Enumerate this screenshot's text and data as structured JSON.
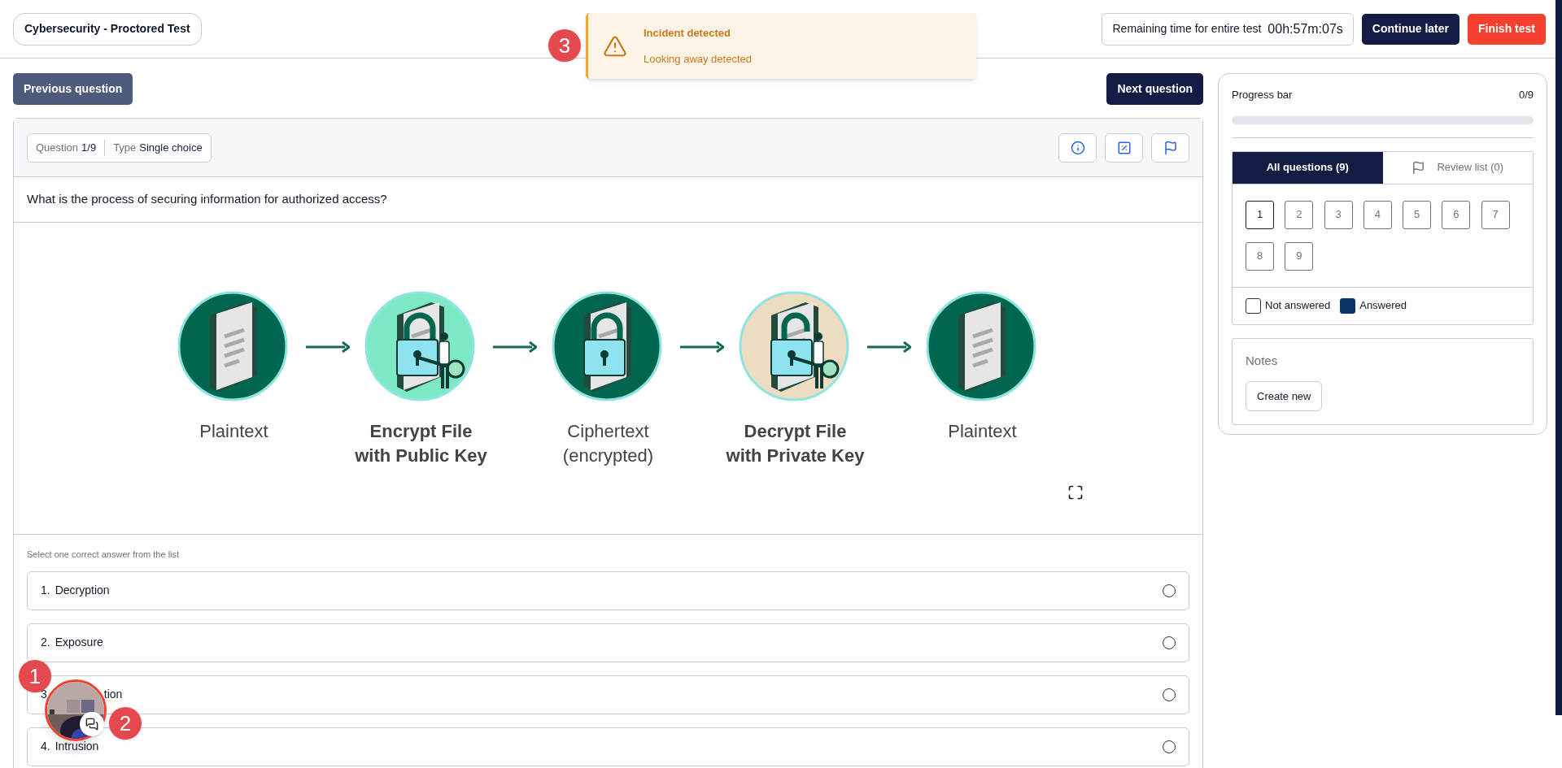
{
  "header": {
    "title": "Cybersecurity - Proctored Test",
    "timer_label": "Remaining time for entire test",
    "timer": "00h:57m:07s",
    "continue": "Continue later",
    "finish": "Finish test"
  },
  "alert": {
    "title": "Incident detected",
    "message": "Looking away detected",
    "badge": "3"
  },
  "nav": {
    "previous": "Previous question",
    "next": "Next question"
  },
  "question": {
    "number_label": "Question",
    "number": "1/9",
    "type_label": "Type",
    "type": "Single choice",
    "text": "What is the process of securing information for authorized access?",
    "diagram": [
      {
        "kind": "document",
        "color": "#00674f",
        "lines": [
          "Plaintext"
        ],
        "bold": false
      },
      {
        "kind": "encrypt",
        "color": "#7de8c5",
        "lines": [
          "Encrypt File",
          "with Public Key"
        ],
        "bold": true
      },
      {
        "kind": "locked",
        "color": "#00674f",
        "lines": [
          "Ciphertext",
          "(encrypted)"
        ],
        "bold": false
      },
      {
        "kind": "decrypt",
        "color": "#ecdcc0",
        "lines": [
          "Decrypt File",
          "with Private Key"
        ],
        "bold": true
      },
      {
        "kind": "document",
        "color": "#00674f",
        "lines": [
          "Plaintext"
        ],
        "bold": false
      }
    ],
    "instruction": "Select one correct answer from the list",
    "options": [
      {
        "kind": "plain",
        "number": "1.",
        "text": "Decryption",
        "selected": false
      },
      {
        "kind": "plain",
        "number": "2.",
        "text": "Exposure",
        "selected": false
      },
      {
        "kind": "covered",
        "number": "3",
        "text": "tion",
        "selected": false
      },
      {
        "kind": "plain",
        "number": "4.",
        "text": "Intrusion",
        "selected": false
      }
    ]
  },
  "webcam": {
    "badges": [
      "1",
      "2"
    ]
  },
  "sidebar": {
    "progress_label": "Progress bar",
    "progress_count": "0/9",
    "level": 0,
    "tabs": [
      {
        "label": "All questions (9)",
        "selected": true
      },
      {
        "label": "Review list (0)",
        "selected": false
      }
    ],
    "questions": [
      {
        "label": "1",
        "selected": true
      },
      {
        "label": "2",
        "selected": false
      },
      {
        "label": "3",
        "selected": false
      },
      {
        "label": "4",
        "selected": false
      },
      {
        "label": "5",
        "selected": false
      },
      {
        "label": "6",
        "selected": false
      },
      {
        "label": "7",
        "selected": false
      },
      {
        "label": "8",
        "selected": false
      },
      {
        "label": "9",
        "selected": false
      }
    ],
    "legend": [
      {
        "label": "Not answered",
        "kind": "empty"
      },
      {
        "label": "Answered",
        "kind": "filled"
      }
    ],
    "notes_title": "Notes",
    "notes_button": "Create new"
  }
}
